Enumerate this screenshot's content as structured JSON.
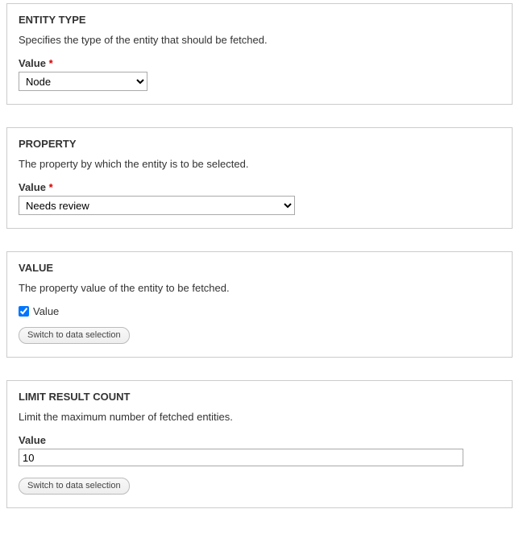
{
  "sections": {
    "entity_type": {
      "heading": "ENTITY TYPE",
      "description": "Specifies the type of the entity that should be fetched.",
      "field_label": "Value",
      "required": "*",
      "value": "Node"
    },
    "property": {
      "heading": "PROPERTY",
      "description": "The property by which the entity is to be selected.",
      "field_label": "Value",
      "required": "*",
      "value": "Needs review"
    },
    "value": {
      "heading": "VALUE",
      "description": "The property value of the entity to be fetched.",
      "checkbox_label": "Value",
      "button_label": "Switch to data selection"
    },
    "limit": {
      "heading": "LIMIT RESULT COUNT",
      "description": "Limit the maximum number of fetched entities.",
      "field_label": "Value",
      "value": "10",
      "button_label": "Switch to data selection"
    }
  }
}
